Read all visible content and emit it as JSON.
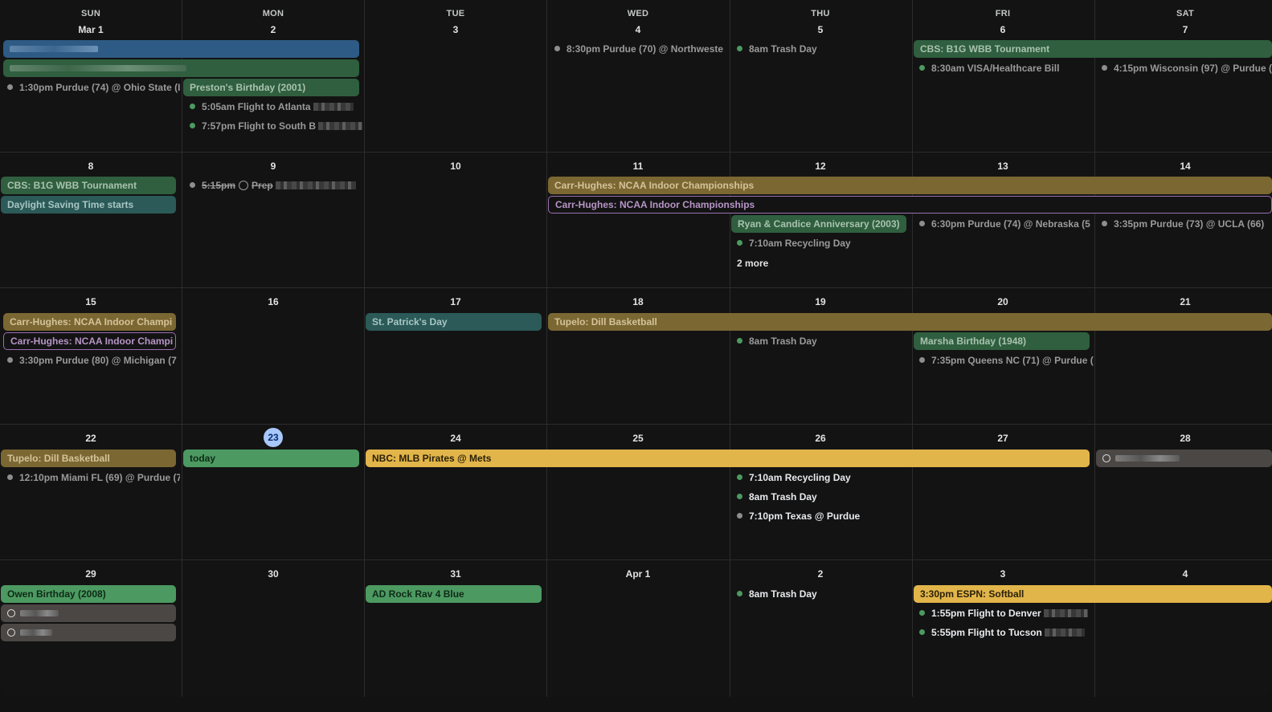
{
  "weekdays": [
    "SUN",
    "MON",
    "TUE",
    "WED",
    "THU",
    "FRI",
    "SAT"
  ],
  "colors": {
    "blue": "#2e5b85",
    "green_dim": "#2f5f3e",
    "green": "#4c9a61",
    "teal": "#2b5a58",
    "olive": "#7b6732",
    "gold": "#e2b54a",
    "purple": "#9c6fb2",
    "gray_pill": "#4b4745",
    "dot_green": "#4c9a61",
    "dot_gray": "#8e8e8e",
    "today_bg": "#a8c7fa"
  },
  "weeks": [
    {
      "days": [
        "Mar 1",
        "2",
        "3",
        "4",
        "5",
        "6",
        "7"
      ]
    },
    {
      "days": [
        "8",
        "9",
        "10",
        "11",
        "12",
        "13",
        "14"
      ]
    },
    {
      "days": [
        "15",
        "16",
        "17",
        "18",
        "19",
        "20",
        "21"
      ]
    },
    {
      "days": [
        "22",
        "23",
        "24",
        "25",
        "26",
        "27",
        "28"
      ]
    },
    {
      "days": [
        "29",
        "30",
        "31",
        "Apr 1",
        "2",
        "3",
        "4"
      ]
    }
  ],
  "today_day": "23",
  "events": {
    "w0_purdue_osu": "1:30pm Purdue (74) @ Ohio State (I",
    "w0_preston": "Preston's Birthday (2001)",
    "w0_flight_atl": "5:05am Flight to Atlanta",
    "w0_flight_sb": "7:57pm Flight to South B",
    "w0_purdue_nw": "8:30pm Purdue (70) @ Northweste",
    "w0_trash": "8am Trash Day",
    "w0_cbs_b1g": "CBS: B1G WBB Tournament",
    "w0_visa": "8:30am VISA/Healthcare Bill",
    "w0_wisc": "4:15pm Wisconsin (97) @ Purdue (9",
    "w1_cbs_b1g": "CBS: B1G WBB Tournament",
    "w1_dst": "Daylight Saving Time starts",
    "w1_prep_time": "5:15pm",
    "w1_prep": "Prep",
    "w1_ncaa_olive": "Carr-Hughes: NCAA Indoor Championships",
    "w1_ncaa_outline": "Carr-Hughes: NCAA Indoor Championships",
    "w1_anniv": "Ryan & Candice Anniversary (2003)",
    "w1_recycling": "7:10am Recycling Day",
    "w1_more": "2 more",
    "w1_nebraska": "6:30pm Purdue (74) @ Nebraska (5",
    "w1_ucla": "3:35pm Purdue (73) @ UCLA (66)",
    "w2_ncaa_olive": "Carr-Hughes: NCAA Indoor Champi",
    "w2_ncaa_outline": "Carr-Hughes: NCAA Indoor Champi",
    "w2_michigan": "3:30pm Purdue (80) @ Michigan (7",
    "w2_stpat": "St. Patrick's Day",
    "w2_tupelo": "Tupelo: Dill Basketball",
    "w2_trash": "8am Trash Day",
    "w2_marsha": "Marsha Birthday (1948)",
    "w2_queens": "7:35pm Queens NC (71) @ Purdue (",
    "w3_tupelo": "Tupelo: Dill Basketball",
    "w3_miami": "12:10pm Miami FL (69) @ Purdue (7",
    "w3_today": "today",
    "w3_nbc": "NBC: MLB Pirates @ Mets",
    "w3_recycling": "7:10am Recycling Day",
    "w3_trash": "8am Trash Day",
    "w3_texas": "7:10pm Texas @ Purdue",
    "w4_owen": "Owen Birthday (2008)",
    "w4_adrock": "AD Rock Rav 4 Blue",
    "w4_trash": "8am Trash Day",
    "w4_espn": "3:30pm ESPN: Softball",
    "w4_denver": "1:55pm Flight to Denver",
    "w4_tucson": "5:55pm Flight to Tucson"
  }
}
